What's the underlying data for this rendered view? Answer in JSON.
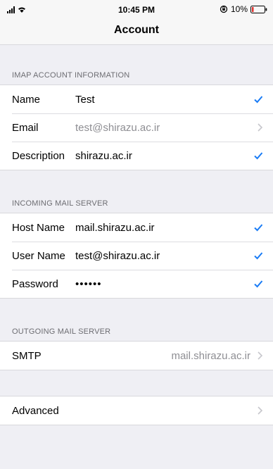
{
  "status": {
    "time": "10:45 PM",
    "battery": "10%",
    "accent": "#1a7cf5"
  },
  "nav": {
    "title": "Account"
  },
  "imap": {
    "header": "IMAP ACCOUNT INFORMATION",
    "name_label": "Name",
    "name_value": "Test",
    "email_label": "Email",
    "email_value": "test@shirazu.ac.ir",
    "description_label": "Description",
    "description_value": "shirazu.ac.ir"
  },
  "incoming": {
    "header": "INCOMING MAIL SERVER",
    "host_label": "Host Name",
    "host_value": "mail.shirazu.ac.ir",
    "user_label": "User Name",
    "user_value": "test@shirazu.ac.ir",
    "password_label": "Password",
    "password_value": "••••••"
  },
  "outgoing": {
    "header": "OUTGOING MAIL SERVER",
    "smtp_label": "SMTP",
    "smtp_value": "mail.shirazu.ac.ir"
  },
  "advanced": {
    "label": "Advanced"
  }
}
